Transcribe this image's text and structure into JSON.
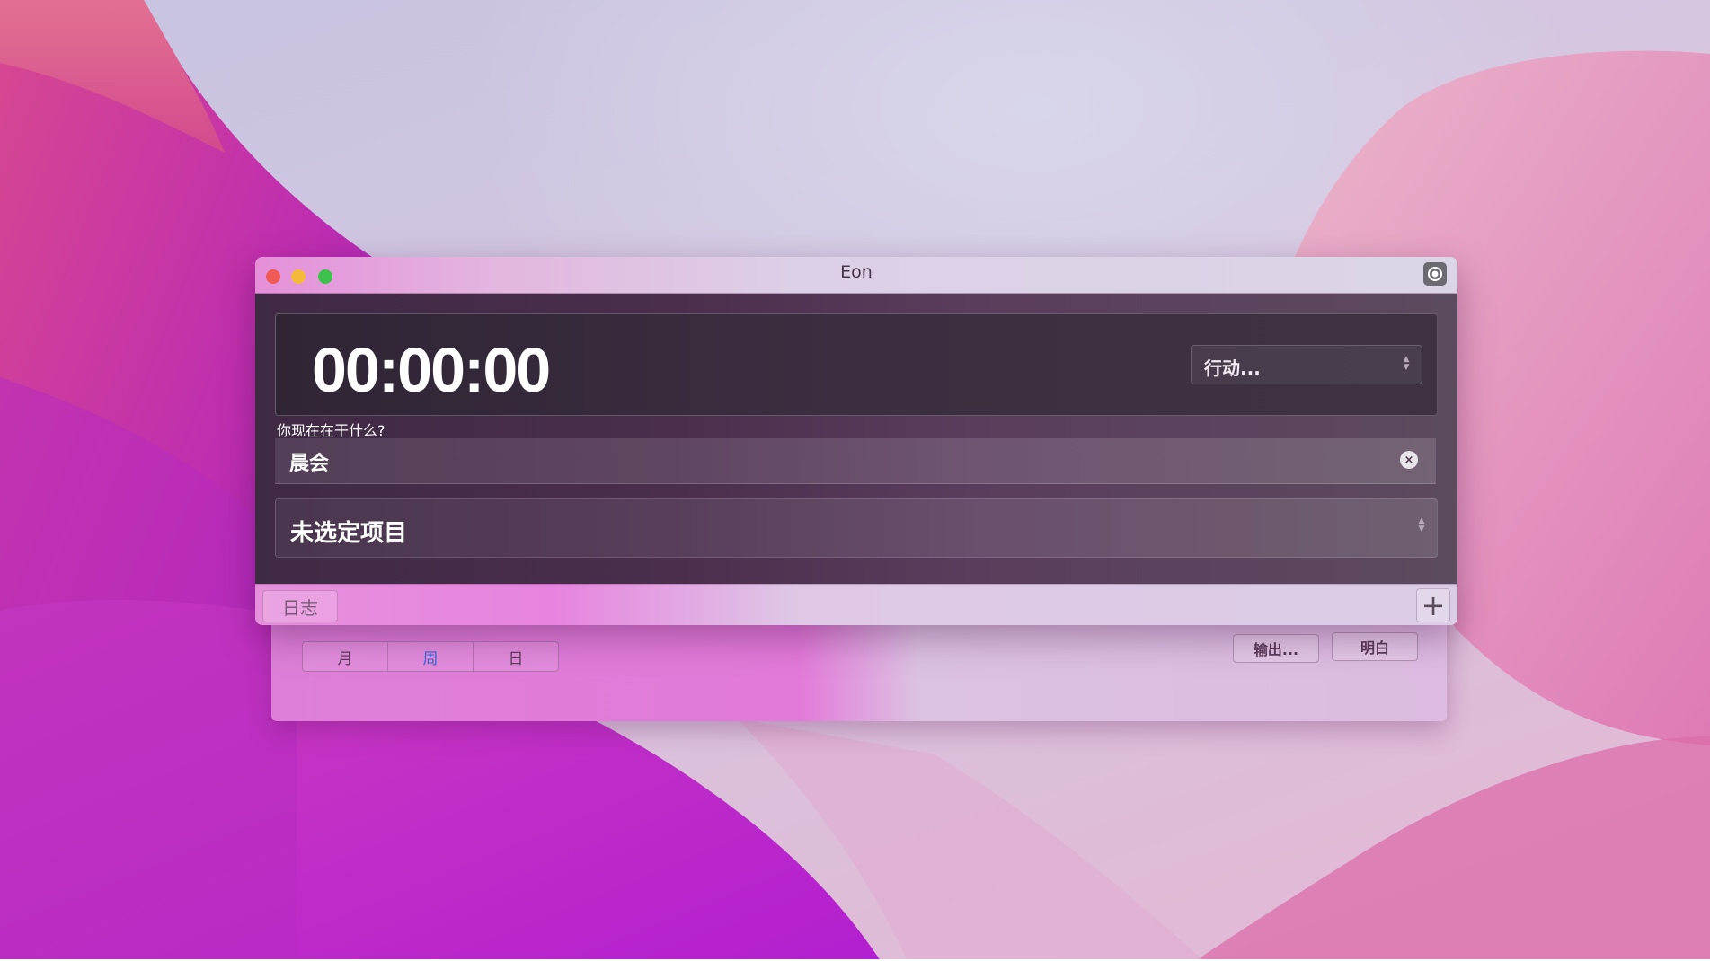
{
  "window": {
    "title": "Eon"
  },
  "timer": {
    "display": "00:00:00",
    "action_label": "行动..."
  },
  "task": {
    "prompt": "你现在在干什么?",
    "value": "晨会",
    "clear_glyph": "×"
  },
  "project": {
    "label": "未选定项目"
  },
  "bottombar": {
    "log_label": "日志",
    "add_glyph": "+"
  },
  "log_panel": {
    "view_tabs": [
      {
        "label": "月",
        "selected": false
      },
      {
        "label": "周",
        "selected": true
      },
      {
        "label": "日",
        "selected": false
      }
    ],
    "export_label": "输出...",
    "ok_label": "明白"
  },
  "colors": {
    "accent_selected": "#3a67d8",
    "close": "#ee5a55",
    "minimize": "#f3b93a",
    "maximize": "#3cc24a"
  }
}
